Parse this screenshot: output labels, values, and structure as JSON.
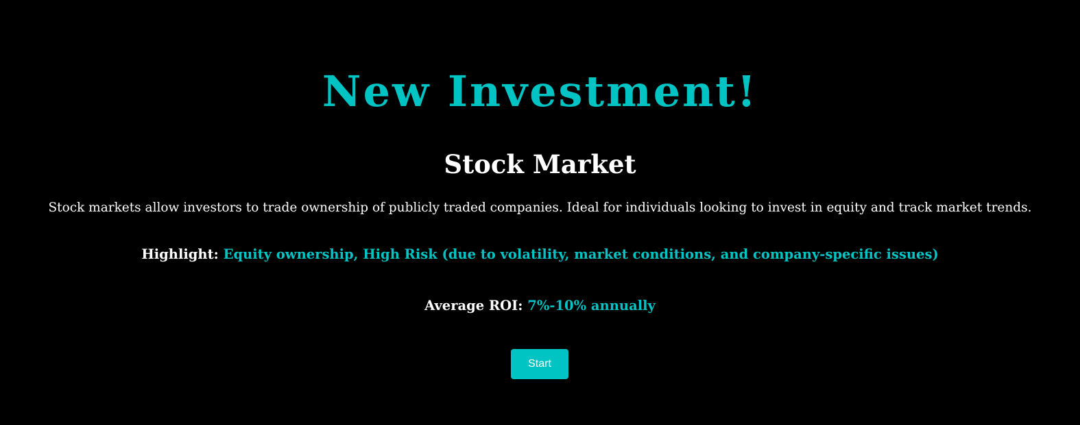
{
  "page": {
    "title": "New Investment!",
    "investment_name": "Stock Market",
    "description": "Stock markets allow investors to trade ownership of publicly traded companies. Ideal for individuals looking to invest in equity and track market trends.",
    "highlight_label": "Highlight:",
    "highlight_value": "Equity ownership, High Risk (due to volatility, market conditions, and company-specific issues)",
    "roi_label": "Average ROI:",
    "roi_value": "7%-10% annually",
    "start_label": "Start"
  },
  "colors": {
    "background": "#000000",
    "accent": "#00c4c4",
    "text": "#ffffff"
  }
}
